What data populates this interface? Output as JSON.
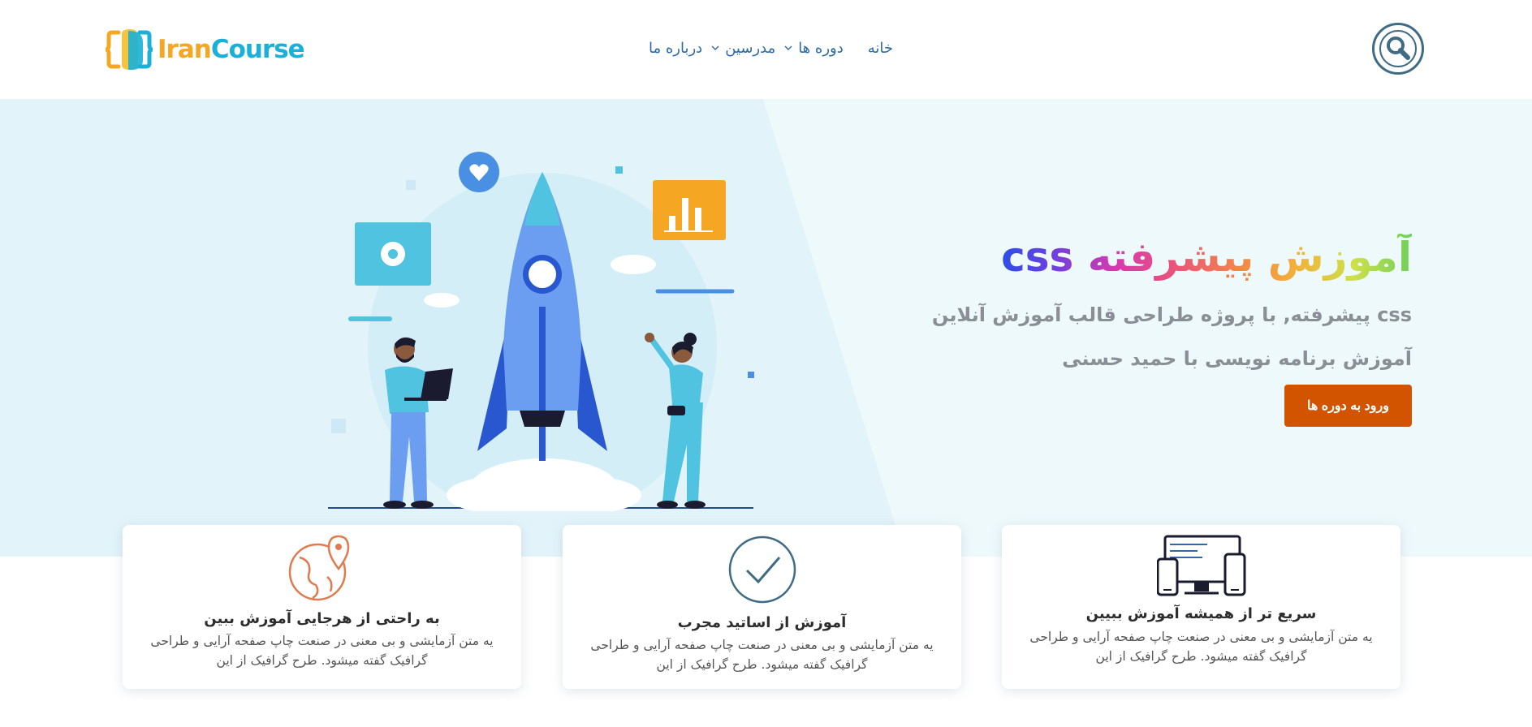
{
  "header": {
    "logo": {
      "part1": "Iran",
      "part2": "Course"
    },
    "nav": {
      "home": "خانه",
      "courses": "دوره ها",
      "teachers": "مدرسین",
      "about": "درباره ما"
    }
  },
  "hero": {
    "title": "آموزش پیشرفته css",
    "line1": "css پیشرفته, با پروژه طراحی قالب آموزش آنلاین",
    "line2": "آموزش برنامه نویسی با حمید حسنی",
    "cta": "ورود به دوره ها"
  },
  "features": [
    {
      "title": "سریع تر از همیشه آموزش ببیین",
      "desc": "یه متن آزمایشی و بی معنی در صنعت چاپ صفحه آرایی و طراحی گرافیک گفته میشود. طرح گرافیک از این",
      "icon": "devices-icon"
    },
    {
      "title": "آموزش از اساتید مجرب",
      "desc": "یه متن آزمایشی و بی معنی در صنعت چاپ صفحه آرایی و طراحی گرافیک گفته میشود. طرح گرافیک از این",
      "icon": "check-circle-icon"
    },
    {
      "title": "به راحتی از هرجایی آموزش ببین",
      "desc": "یه متن آزمایشی و بی معنی در صنعت چاپ صفحه آرایی و طراحی گرافیک گفته میشود. طرح گرافیک از این",
      "icon": "globe-pin-icon"
    }
  ],
  "colors": {
    "nav_link": "#2c6aa8",
    "cta_bg": "#d35400",
    "hero_bg": "#eaf7fb",
    "search_border": "#3f6b85",
    "globe_icon": "#e07a4f"
  }
}
